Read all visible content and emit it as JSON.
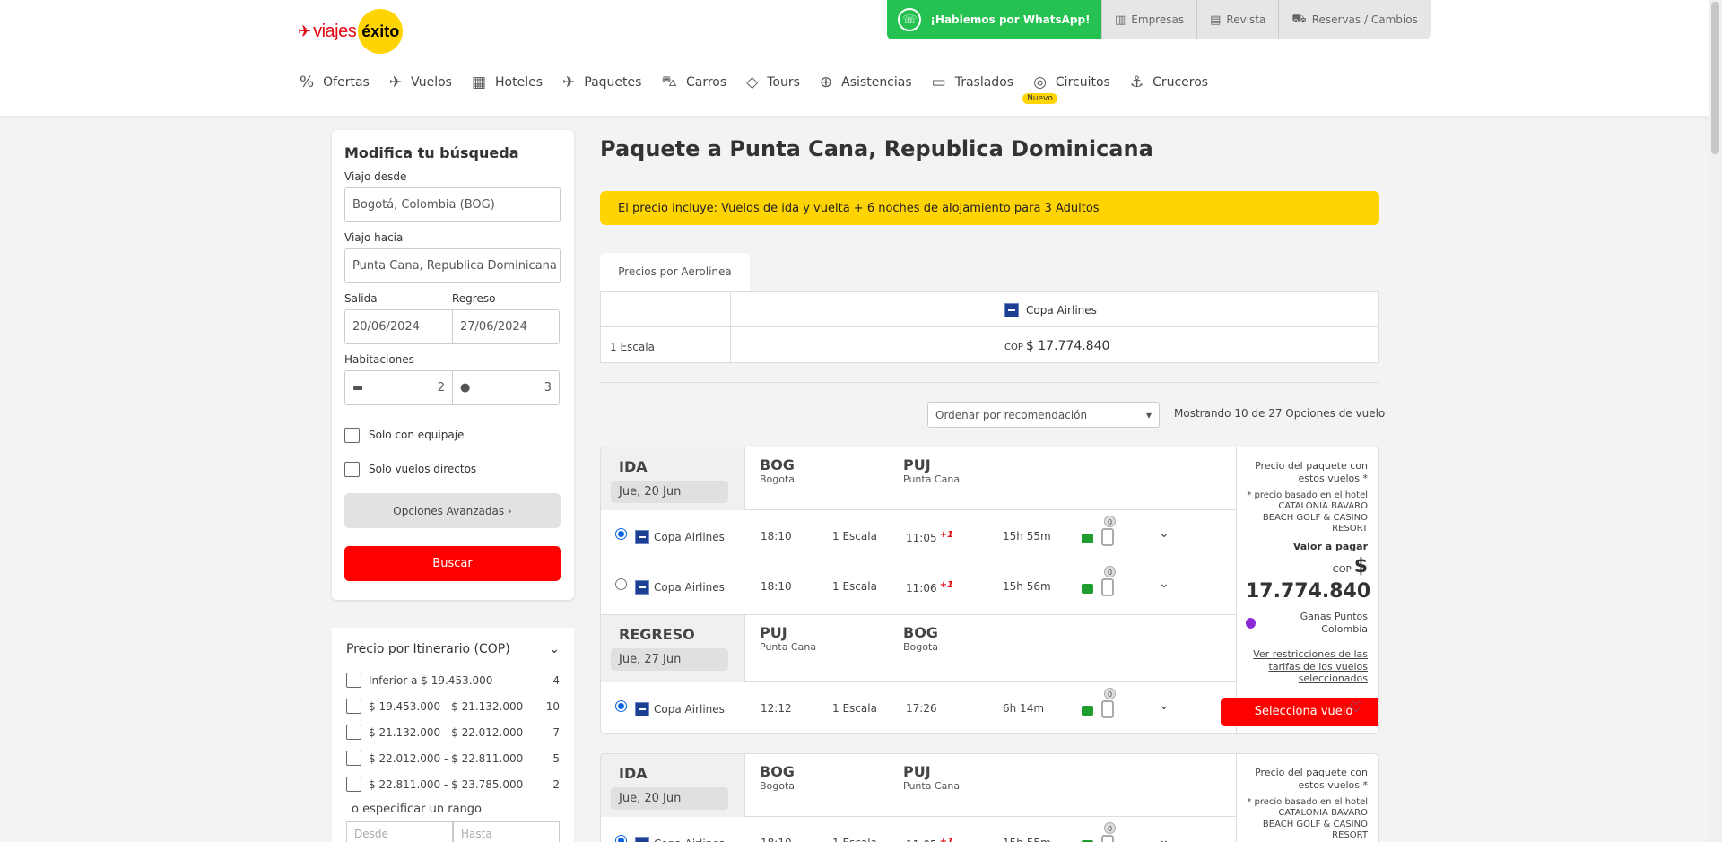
{
  "brand": {
    "mark": "✈",
    "name": "viajes",
    "circle": "éxito"
  },
  "topbar": {
    "whatsapp": "¡Hablemos por WhatsApp!",
    "links": [
      {
        "label": "Empresas",
        "icon": "building-icon"
      },
      {
        "label": "Revista",
        "icon": "magazine-icon"
      },
      {
        "label": "Reservas / Cambios",
        "icon": "cart-icon"
      }
    ]
  },
  "nav": [
    {
      "label": "Ofertas",
      "icon": "%"
    },
    {
      "label": "Vuelos",
      "icon": "✈"
    },
    {
      "label": "Hoteles",
      "icon": "▦"
    },
    {
      "label": "Paquetes",
      "icon": "✈"
    },
    {
      "label": "Carros",
      "icon": "⛍"
    },
    {
      "label": "Tours",
      "icon": "◇"
    },
    {
      "label": "Asistencias",
      "icon": "⊕"
    },
    {
      "label": "Traslados",
      "icon": "▭"
    },
    {
      "label": "Circuitos",
      "icon": "◎"
    },
    {
      "label": "Cruceros",
      "icon": "⚓"
    }
  ],
  "nav_badge": "Nuevo",
  "search": {
    "title": "Modifica tu búsqueda",
    "from_label": "Viajo desde",
    "from_value": "Bogotá, Colombia (BOG)",
    "to_label": "Viajo hacia",
    "to_value": "Punta Cana, Republica Dominicana",
    "dep_label": "Salida",
    "dep_value": "20/06/2024",
    "ret_label": "Regreso",
    "ret_value": "27/06/2024",
    "rooms_label": "Habitaciones",
    "rooms": "2",
    "people": "3",
    "chk_baggage": "Solo con equipaje",
    "chk_direct": "Solo vuelos directos",
    "advanced": "Opciones Avanzadas ›",
    "search_btn": "Buscar"
  },
  "filter": {
    "title": "Precio por Itinerario (COP)",
    "ranges": [
      {
        "label": "Inferior a $ 19.453.000",
        "count": "4"
      },
      {
        "label": "$ 19.453.000 - $ 21.132.000",
        "count": "10"
      },
      {
        "label": "$ 21.132.000 - $ 22.012.000",
        "count": "7"
      },
      {
        "label": "$ 22.012.000 - $ 22.811.000",
        "count": "5"
      },
      {
        "label": "$ 22.811.000 - $ 23.785.000",
        "count": "2"
      }
    ],
    "range_label": "o especificar un rango",
    "from_ph": "Desde",
    "to_ph": "Hasta"
  },
  "main": {
    "title": "Paquete a Punta Cana, Republica Dominicana",
    "notice": "El precio incluye: Vuelos de ida y vuelta + 6 noches de alojamiento para 3 Adultos",
    "tab": "Precios por Aerolinea",
    "airline": "Copa Airlines",
    "stops": "1 Escala",
    "currency": "COP",
    "price": "$ 17.774.840",
    "sort": "Ordenar por recomendación",
    "showing": "Mostrando 10 de 27 Opciones de vuelo"
  },
  "card": {
    "ida": "IDA",
    "ida_date": "Jue, 20 Jun",
    "regreso": "REGRESO",
    "ret_date": "Jue, 27 Jun",
    "bog": "BOG",
    "bog_city": "Bogota",
    "puj": "PUJ",
    "puj_city": "Punta Cana",
    "flights_out": [
      {
        "airline": "Copa Airlines",
        "dep": "18:10",
        "stops": "1 Escala",
        "arr": "11:05",
        "plus": "+1",
        "dur": "15h 55m",
        "bags": "0"
      },
      {
        "airline": "Copa Airlines",
        "dep": "18:10",
        "stops": "1 Escala",
        "arr": "11:06",
        "plus": "+1",
        "dur": "15h 56m",
        "bags": "0"
      }
    ],
    "flight_ret": {
      "airline": "Copa Airlines",
      "dep": "12:12",
      "stops": "1 Escala",
      "arr": "17:26",
      "dur": "6h 14m",
      "bags": "0"
    },
    "price_title": "Precio del paquete con estos vuelos *",
    "price_note": "* precio basado en el hotel CATALONIA BAVARO BEACH GOLF & CASINO RESORT",
    "pay_label": "Valor a pagar",
    "points": "Ganas Puntos Colombia",
    "restrictions": "Ver restricciones de las tarifas de los vuelos seleccionados",
    "select_btn": "Selecciona vuelo"
  }
}
